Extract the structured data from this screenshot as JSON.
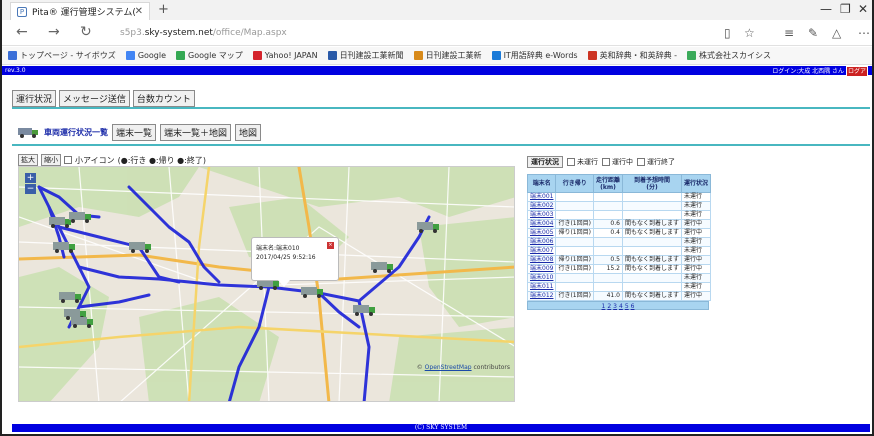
{
  "browser": {
    "tab_title": "Pita® 運行管理システム(",
    "url_prefix": "s5p3.",
    "url_domain": "sky-system.net",
    "url_path": "/office/Map.aspx"
  },
  "bookmarks": [
    {
      "label": "トップページ - サイボウズ",
      "color": "#3a6fd8"
    },
    {
      "label": "Google",
      "color": "#4285f4"
    },
    {
      "label": "Google マップ",
      "color": "#34a853"
    },
    {
      "label": "Yahoo! JAPAN",
      "color": "#d4242c"
    },
    {
      "label": "日刊建設工業新聞",
      "color": "#2a5aa8"
    },
    {
      "label": "日刊建設工業新",
      "color": "#d88a1a"
    },
    {
      "label": "IT用語辞典 e-Words",
      "color": "#1a7ad8"
    },
    {
      "label": "英和辞典・和英辞典 -",
      "color": "#cc3322"
    },
    {
      "label": "株式会社スカイシス",
      "color": "#3aaa5a"
    }
  ],
  "header": {
    "rev": "rev.3.0",
    "login": "ログイン:大成 北西隅 さん",
    "logout": "ログア"
  },
  "topnav": [
    "運行状況",
    "メッセージ送信",
    "台数カウント"
  ],
  "subnav": {
    "current": "車両運行状況一覧",
    "items": [
      "端末一覧",
      "端末一覧＋地図",
      "地図"
    ]
  },
  "map_controls": {
    "zoom_in": "拡大",
    "zoom_out": "縮小",
    "small_icon": "小アイコン",
    "legend": "(●:行き ●:帰り ●:終了)",
    "legend_colors": {
      "go": "#d82020",
      "return": "#30a030",
      "end": "#8a6a30"
    }
  },
  "map": {
    "zoom_plus": "+",
    "zoom_minus": "−",
    "popup_line1": "端末名:端末010",
    "popup_line2": "2017/04/25 9:52:16",
    "popup_close": "×",
    "attribution_sym": "©",
    "attribution_link": "OpenStreetMap",
    "attribution_rest": "contributors"
  },
  "status": {
    "header": "運行状況",
    "filters": [
      "未運行",
      "運行中",
      "運行終了"
    ],
    "columns": [
      "端末名",
      "行き帰り",
      "走行距離\n(km)",
      "到着予想時間\n(分)",
      "運行状況"
    ],
    "rows": [
      [
        "端末001",
        "",
        "",
        "",
        "未運行"
      ],
      [
        "端末002",
        "",
        "",
        "",
        "未運行"
      ],
      [
        "端末003",
        "",
        "",
        "",
        "未運行"
      ],
      [
        "端末004",
        "行き(1回目)",
        "0.6",
        "間もなく到着します",
        "運行中"
      ],
      [
        "端末005",
        "帰り(1回目)",
        "0.4",
        "間もなく到着します",
        "運行中"
      ],
      [
        "端末006",
        "",
        "",
        "",
        "未運行"
      ],
      [
        "端末007",
        "",
        "",
        "",
        "未運行"
      ],
      [
        "端末008",
        "帰り(1回目)",
        "0.5",
        "間もなく到着します",
        "運行中"
      ],
      [
        "端末009",
        "行き(1回目)",
        "15.2",
        "間もなく到着します",
        "運行中"
      ],
      [
        "端末010",
        "",
        "",
        "",
        "未運行"
      ],
      [
        "端末011",
        "",
        "",
        "",
        "未運行"
      ],
      [
        "端末012",
        "行き(1回目)",
        "41.0",
        "間もなく到着します",
        "運行中"
      ]
    ],
    "pages": [
      "1",
      "2",
      "3",
      "4",
      "5",
      "6"
    ]
  },
  "footer": "(C) SKY SYSTEM"
}
